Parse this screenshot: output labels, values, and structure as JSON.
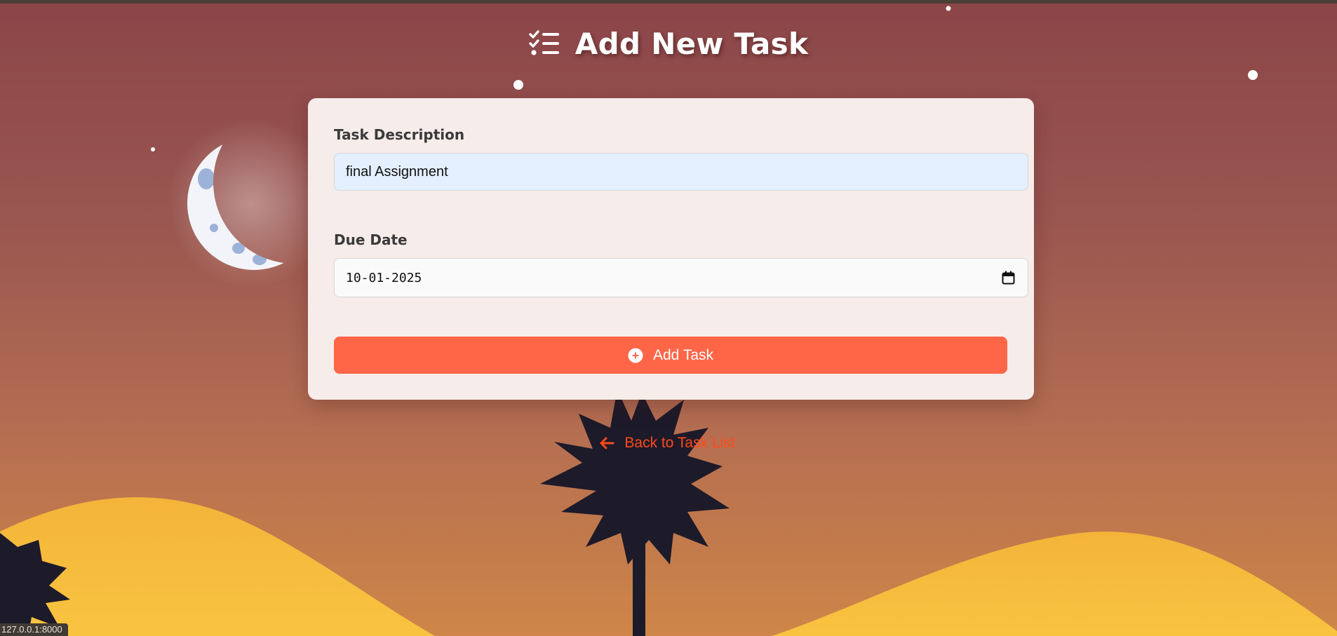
{
  "page": {
    "title": "Add New Task",
    "title_icon": "task-list-icon"
  },
  "form": {
    "description_label": "Task Description",
    "description_value": "final Assignment",
    "due_date_label": "Due Date",
    "due_date_value": "10-01-2025",
    "submit_label": "Add Task",
    "submit_icon": "plus-circle-icon"
  },
  "nav": {
    "back_label": "Back to Task List",
    "back_icon": "arrow-left-icon"
  },
  "status_bar": {
    "url": "127.0.0.1:8000"
  },
  "colors": {
    "accent": "#ff6648",
    "link": "#ff4a1c",
    "card": "#f6ecea",
    "description_input_bg": "#e4efff",
    "date_input_bg": "#fafafa"
  }
}
